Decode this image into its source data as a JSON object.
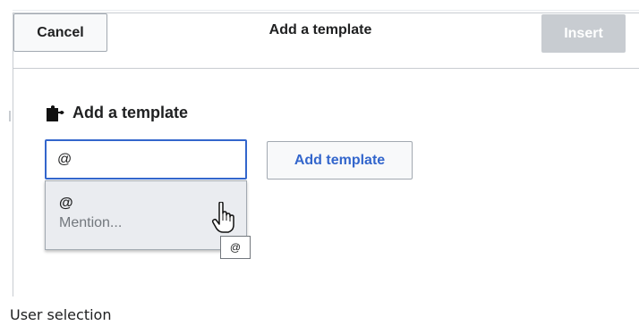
{
  "dialog": {
    "cancel_label": "Cancel",
    "title": "Add a template",
    "insert_label": "Insert"
  },
  "section": {
    "title": "Add a template",
    "icon": "puzzle-icon"
  },
  "search": {
    "value": "@",
    "add_button_label": "Add template"
  },
  "suggestions": [
    {
      "title": "@",
      "description": "Mention..."
    }
  ],
  "cursor": {
    "icon": "hand-pointer-icon",
    "tooltip": "@"
  },
  "caption": "User selection",
  "colors": {
    "accent": "#3366cc",
    "disabled_button": "#c8ccd1",
    "suggestion_bg": "#eaecf0",
    "muted_text": "#72777d"
  }
}
